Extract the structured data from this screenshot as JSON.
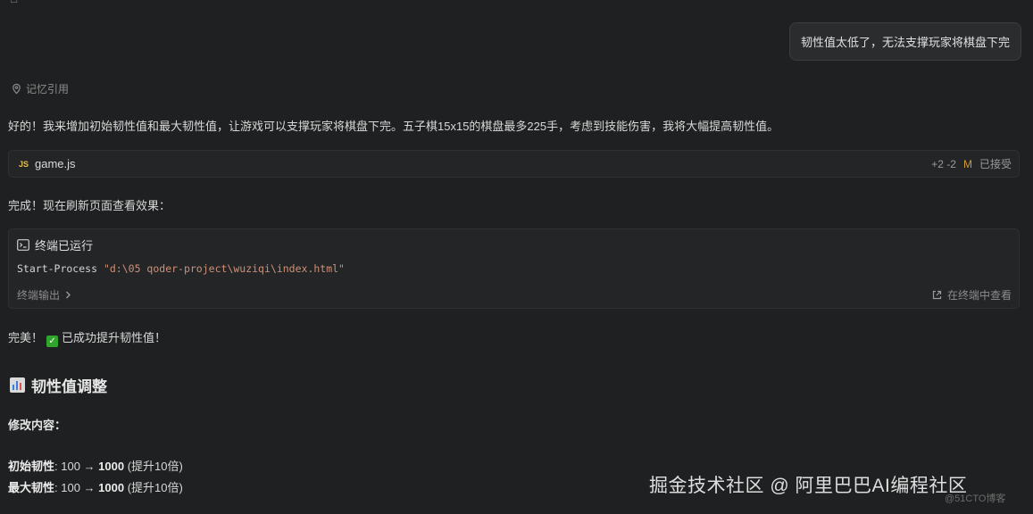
{
  "top_partial": "□",
  "user_message": "韧性值太低了，无法支撑玩家将棋盘下完",
  "memory_label": "记忆引用",
  "intro_text": "好的！我来增加初始韧性值和最大韧性值，让游戏可以支撑玩家将棋盘下完。五子棋15x15的棋盘最多225手，考虑到技能伤害，我将大幅提高韧性值。",
  "file_card": {
    "badge": "JS",
    "file_name": "game.js",
    "diff": "+2 -2",
    "status_badge": "M",
    "accepted": "已接受"
  },
  "done_text": "完成！现在刷新页面查看效果：",
  "terminal": {
    "title": "终端已运行",
    "command": "Start-Process",
    "argument": "\"d:\\05 qoder-project\\wuziqi\\index.html\"",
    "output_label": "终端输出",
    "view_label": "在终端中查看"
  },
  "success": {
    "prefix": "完美！",
    "check_icon": "✓",
    "text": "已成功提升韧性值！"
  },
  "section_heading": "韧性值调整",
  "modify_label": "修改内容：",
  "details": [
    {
      "label": "初始韧性",
      "from": ": 100 → ",
      "to": "1000",
      "note": " (提升10倍)"
    },
    {
      "label": "最大韧性",
      "from": ": 100 → ",
      "to": "1000",
      "note": " (提升10倍)"
    }
  ],
  "watermark": "掘金技术社区 @ 阿里巴巴AI编程社区",
  "watermark_small": "@51CTO博客"
}
